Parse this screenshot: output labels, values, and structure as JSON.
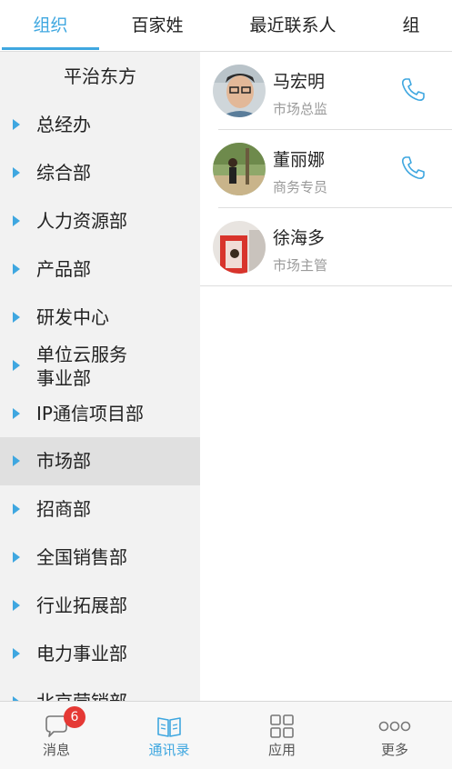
{
  "top_tabs": [
    {
      "label": "组织"
    },
    {
      "label": "百家姓"
    },
    {
      "label": "最近联系人"
    },
    {
      "label": "组"
    }
  ],
  "sidebar": {
    "title": "平治东方",
    "items": [
      {
        "label": "总经办"
      },
      {
        "label": "综合部"
      },
      {
        "label": "人力资源部"
      },
      {
        "label": "产品部"
      },
      {
        "label": "研发中心"
      },
      {
        "label": "单位云服务事业部"
      },
      {
        "label": "IP通信项目部"
      },
      {
        "label": "市场部"
      },
      {
        "label": "招商部"
      },
      {
        "label": "全国销售部"
      },
      {
        "label": "行业拓展部"
      },
      {
        "label": "电力事业部"
      },
      {
        "label": "北京营销部"
      }
    ]
  },
  "contacts": [
    {
      "name": "马宏明",
      "role": "市场总监"
    },
    {
      "name": "董丽娜",
      "role": "商务专员"
    },
    {
      "name": "徐海多",
      "role": "市场主管"
    }
  ],
  "bottom_nav": [
    {
      "label": "消息",
      "badge": "6"
    },
    {
      "label": "通讯录"
    },
    {
      "label": "应用"
    },
    {
      "label": "更多"
    }
  ],
  "colors": {
    "accent": "#3fa7e0",
    "badge": "#e53935",
    "sidebar_bg": "#f2f2f2"
  }
}
